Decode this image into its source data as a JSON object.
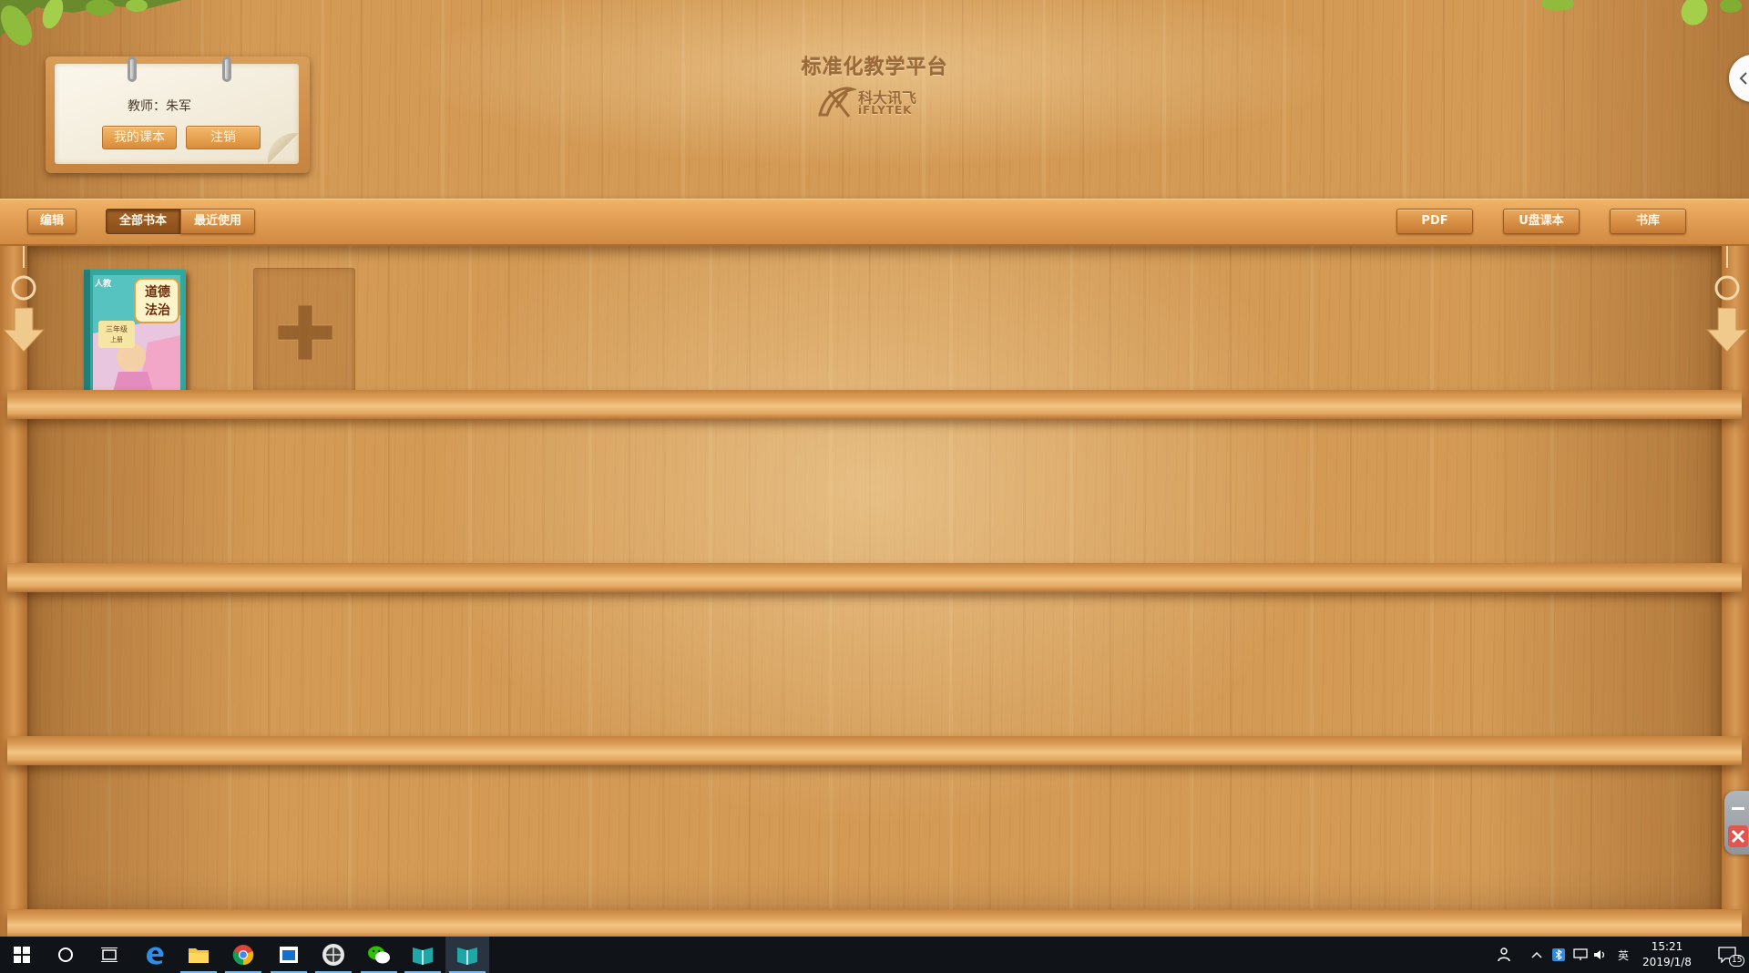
{
  "window": {
    "app_title": "标准化教学平台",
    "brand_cn": "科大讯飞",
    "brand_en": "iFLYTEK"
  },
  "teacher_card": {
    "teacher_label": "教师：朱军",
    "my_textbooks_label": "我的课本",
    "logout_label": "注销"
  },
  "toolbar": {
    "edit_label": "编辑",
    "tabs": [
      {
        "label": "全部书本",
        "active": true
      },
      {
        "label": "最近使用",
        "active": false
      }
    ],
    "pdf_label": "PDF",
    "usb_textbook_label": "U盘课本",
    "library_label": "书库"
  },
  "shelf": {
    "books": [
      {
        "title_line1": "道德",
        "title_line2": "法治",
        "grade": "三年级",
        "volume": "上册",
        "publisher_mark": "人教"
      }
    ]
  },
  "colors": {
    "wood_base": "#d39a55",
    "toolbar": "#e4a057",
    "button_active": "#8a4f1b",
    "taskbar": "#101418",
    "close_red": "#e0564f"
  },
  "taskbar": {
    "apps": [
      {
        "icon": "edge-icon"
      },
      {
        "icon": "file-explorer-icon"
      },
      {
        "icon": "chrome-icon"
      },
      {
        "icon": "store-icon"
      },
      {
        "icon": "globe-app-icon"
      },
      {
        "icon": "wechat-icon"
      },
      {
        "icon": "textbook-app-icon"
      },
      {
        "icon": "textbook-app-icon"
      }
    ],
    "ime_label": "英",
    "time": "15:21",
    "date": "2019/1/8",
    "notification_count": "15"
  }
}
